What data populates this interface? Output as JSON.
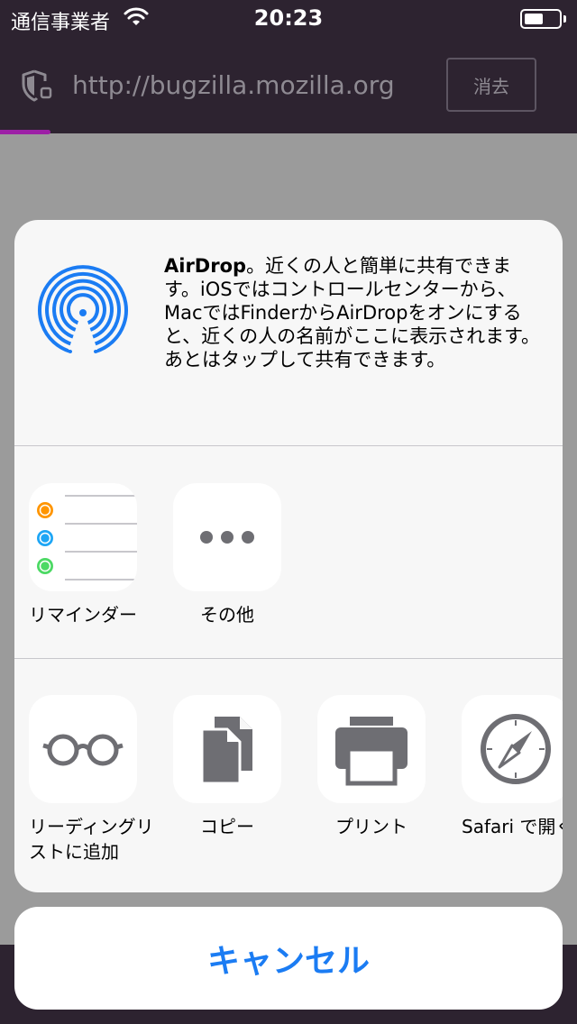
{
  "status_bar": {
    "carrier": "通信事業者",
    "time": "20:23"
  },
  "browser": {
    "url": "http://bugzilla.mozilla.org",
    "clear_label": "消去",
    "accent": "#9d1fa6"
  },
  "share_sheet": {
    "airdrop": {
      "title": "AirDrop",
      "description": "。近くの人と簡単に共有できます。iOSではコントロールセンターから、MacではFinderからAirDropをオンにすると、近くの人の名前がここに表示されます。あとはタップして共有できます。"
    },
    "apps": [
      {
        "label": "リマインダー",
        "icon": "reminders-icon"
      },
      {
        "label": "その他",
        "icon": "more-icon"
      }
    ],
    "actions": [
      {
        "label": "リーディングリストに追加",
        "icon": "glasses-icon"
      },
      {
        "label": "コピー",
        "icon": "copy-icon"
      },
      {
        "label": "プリント",
        "icon": "printer-icon"
      },
      {
        "label": "Safari で開く",
        "icon": "compass-icon"
      }
    ],
    "cancel_label": "キャンセル",
    "accent_color": "#1b7cf3"
  }
}
